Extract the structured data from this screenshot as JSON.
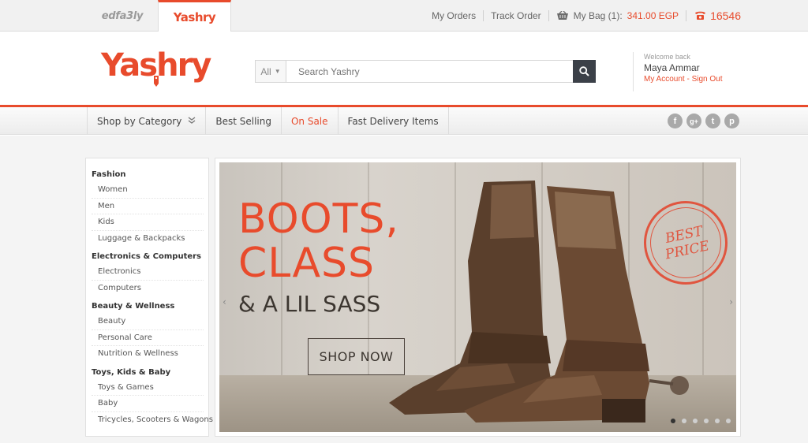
{
  "site_tabs": [
    {
      "label": "edfa3ly"
    },
    {
      "label": "Yashry"
    }
  ],
  "top_links": {
    "orders": "My Orders",
    "track": "Track Order",
    "bag_label": "My Bag (1):",
    "bag_total": "341.00 EGP",
    "phone": "16546"
  },
  "logo": "Yashry",
  "search": {
    "scope": "All",
    "placeholder": "Search Yashry"
  },
  "account": {
    "welcome": "Welcome back",
    "name": "Maya Ammar",
    "my_account": "My Account",
    "separator": " - ",
    "sign_out": "Sign Out"
  },
  "nav": {
    "items": [
      {
        "label": "Shop by Category"
      },
      {
        "label": "Best Selling"
      },
      {
        "label": "On Sale"
      },
      {
        "label": "Fast Delivery Items"
      }
    ],
    "socials": [
      "f",
      "g+",
      "t",
      "p"
    ]
  },
  "sidebar": {
    "groups": [
      {
        "title": "Fashion",
        "items": [
          "Women",
          "Men",
          "Kids",
          "Luggage & Backpacks"
        ]
      },
      {
        "title": "Electronics & Computers",
        "items": [
          "Electronics",
          "Computers"
        ]
      },
      {
        "title": "Beauty & Wellness",
        "items": [
          "Beauty",
          "Personal Care",
          "Nutrition & Wellness"
        ]
      },
      {
        "title": "Toys, Kids & Baby",
        "items": [
          "Toys & Games",
          "Baby",
          "Tricycles, Scooters & Wagons"
        ]
      }
    ]
  },
  "banner": {
    "line1": "BOOTS,",
    "line2": "CLASS",
    "line3": "& A LIL SASS",
    "cta": "SHOP NOW",
    "stamp_line1": "BEST",
    "stamp_line2": "PRICE",
    "slide_count": 6,
    "active_slide": 1
  },
  "colors": {
    "brand": "#e84b2c",
    "dark": "#3b4048",
    "social": "#a9a9a9"
  }
}
